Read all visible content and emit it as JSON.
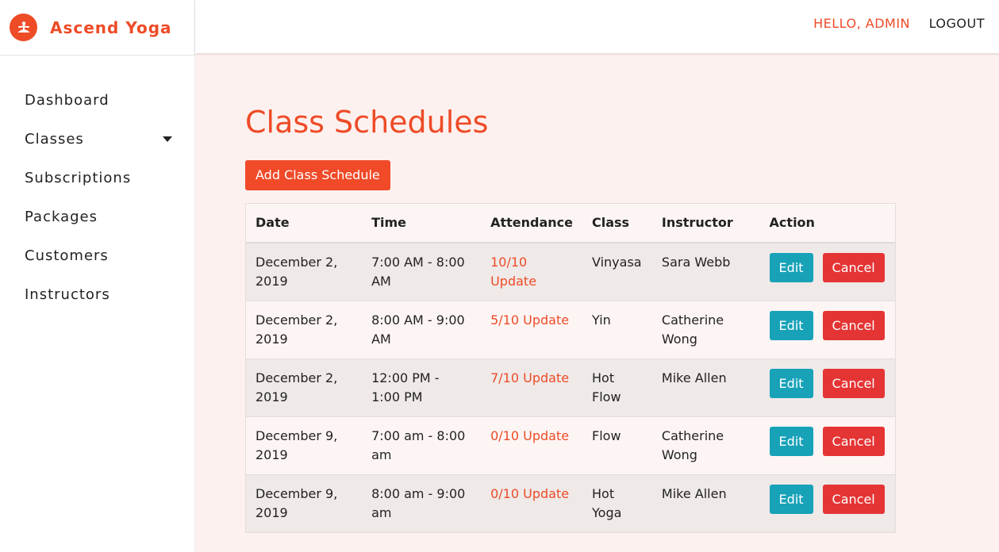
{
  "brand": {
    "name": "Ascend Yoga",
    "logo_icon": "yoga-pose-icon",
    "color": "#ee4b27"
  },
  "nav": {
    "items": [
      {
        "label": "Dashboard"
      },
      {
        "label": "Classes",
        "has_dropdown": true
      },
      {
        "label": "Subscriptions"
      },
      {
        "label": "Packages"
      },
      {
        "label": "Customers"
      },
      {
        "label": "Instructors"
      }
    ]
  },
  "topbar": {
    "greeting": "HELLO, ADMIN",
    "logout": "LOGOUT"
  },
  "page": {
    "title": "Class Schedules",
    "add_button": "Add Class Schedule"
  },
  "table": {
    "headers": [
      "Date",
      "Time",
      "Attendance",
      "Class",
      "Instructor",
      "Action"
    ],
    "rows": [
      {
        "date": "December 2, 2019",
        "time": "7:00 AM - 8:00 AM",
        "attendance": "10/10 Update",
        "class": "Vinyasa",
        "instructor": "Sara Webb"
      },
      {
        "date": "December 2, 2019",
        "time": "8:00 AM - 9:00 AM",
        "attendance": "5/10 Update",
        "class": "Yin",
        "instructor": "Catherine Wong"
      },
      {
        "date": "December 2, 2019",
        "time": "12:00 PM - 1:00 PM",
        "attendance": "7/10 Update",
        "class": "Hot Flow",
        "instructor": "Mike Allen"
      },
      {
        "date": "December 9, 2019",
        "time": "7:00 am - 8:00 am",
        "attendance": "0/10 Update",
        "class": "Flow",
        "instructor": "Catherine Wong"
      },
      {
        "date": "December 9, 2019",
        "time": "8:00 am - 9:00 am",
        "attendance": "0/10 Update",
        "class": "Hot Yoga",
        "instructor": "Mike Allen"
      }
    ],
    "edit_label": "Edit",
    "cancel_label": "Cancel"
  },
  "colors": {
    "accent": "#ee4b27",
    "edit": "#17a2b8",
    "cancel": "#e53434"
  }
}
